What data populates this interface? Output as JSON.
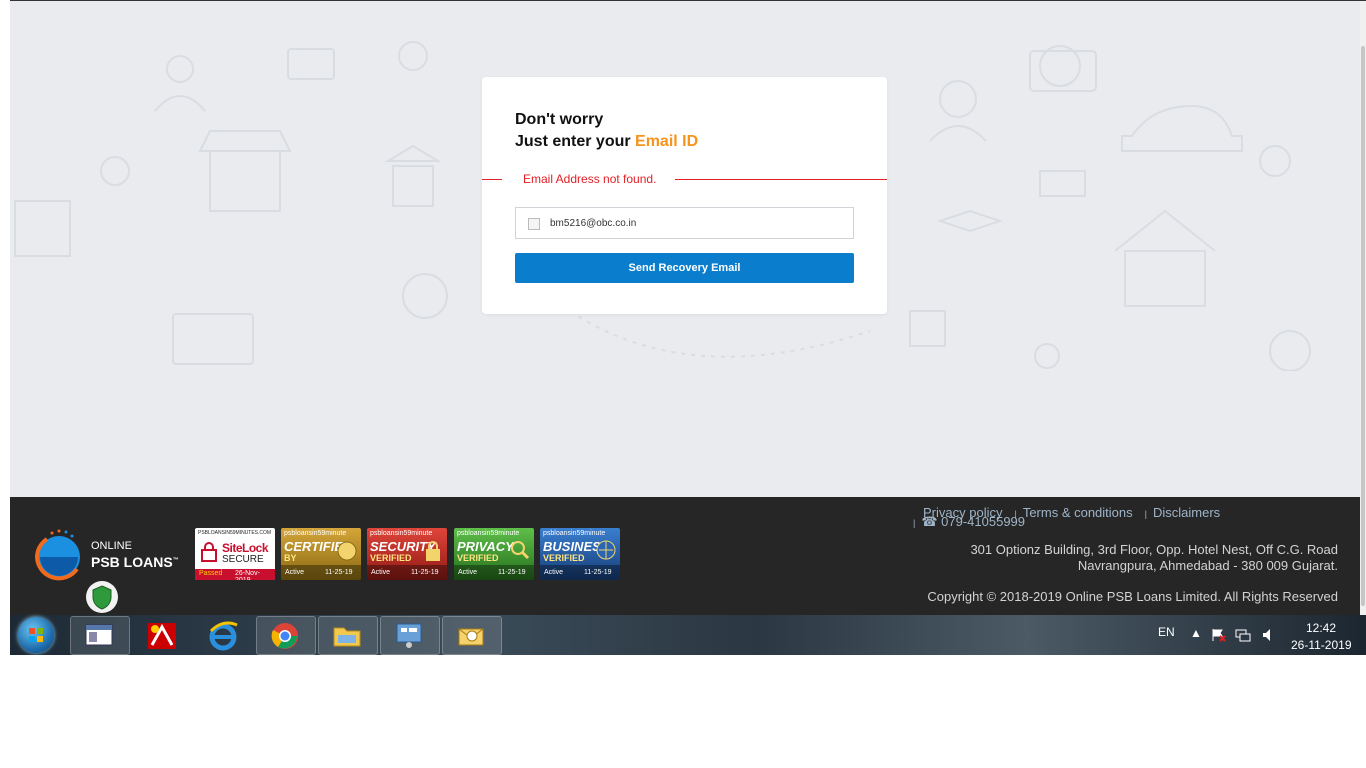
{
  "card": {
    "line1": "Don't worry",
    "line2_prefix": "Just enter your ",
    "line2_accent": "Email ID",
    "error": "Email Address not found.",
    "email_value": "bm5216@obc.co.in",
    "button_label": "Send Recovery Email"
  },
  "footer": {
    "logo_small": "ONLINE",
    "logo_big": "PSB LOANS",
    "logo_tm": "™",
    "badges": [
      {
        "top": "PSBLOANSIN59MINUTES.COM",
        "main": "SiteLock",
        "sub": "SECURE",
        "bottom_left": "Passed",
        "bottom_right": "26-Nov-2019"
      },
      {
        "top": "psbloansin59minute",
        "main": "CERTIFIED",
        "sub": "BY",
        "bottom_left": "Active",
        "bottom_right": "11-25-19"
      },
      {
        "top": "psbloansin59minute",
        "main": "SECURITY",
        "sub": "VERIFIED",
        "bottom_left": "Active",
        "bottom_right": "11-25-19"
      },
      {
        "top": "psbloansin59minute",
        "main": "PRIVACY",
        "sub": "VERIFIED",
        "bottom_left": "Active",
        "bottom_right": "11-25-19"
      },
      {
        "top": "psbloansin59minute",
        "main": "BUSINESS",
        "sub": "VERIFIED",
        "bottom_left": "Active",
        "bottom_right": "11-25-19"
      }
    ],
    "links": {
      "privacy": "Privacy policy",
      "terms": "Terms & conditions",
      "disclaimers": "Disclaimers"
    },
    "phone": "☎ 079-41055999",
    "address_line1": "301 Optionz Building, 3rd Floor, Opp. Hotel Nest, Off C.G. Road",
    "address_line2": "Navrangpura, Ahmedabad - 380 009 Gujarat.",
    "copyright": "Copyright © 2018-2019 Online PSB Loans Limited. All Rights Reserved"
  },
  "taskbar": {
    "language": "EN",
    "time": "12:42",
    "date": "26-11-2019"
  },
  "colors": {
    "accent_orange": "#f7941d",
    "button_blue": "#0a7dcc",
    "error_red": "#e31e24",
    "footer_bg": "#262626"
  }
}
